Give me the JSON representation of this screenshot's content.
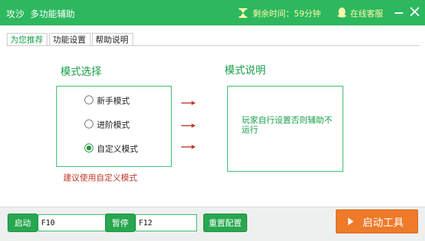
{
  "window": {
    "app_name": "攻沙",
    "subtitle": "多功能辅助",
    "timer_text": "剩余时间：59分钟",
    "service_text": "在线客服",
    "title_bg": "#2db85f"
  },
  "tabs": [
    {
      "label": "为您推荐",
      "active": true
    },
    {
      "label": "功能设置",
      "active": false
    },
    {
      "label": "帮助说明",
      "active": false
    }
  ],
  "mode_section": {
    "title": "模式选择",
    "options": [
      {
        "label": "新手模式",
        "checked": false
      },
      {
        "label": "进阶模式",
        "checked": false
      },
      {
        "label": "自定义模式",
        "checked": true
      }
    ],
    "suggestion": "建议使用自定义模式"
  },
  "description": {
    "title": "模式说明",
    "text": "玩家自行设置否则辅助不运行"
  },
  "bottom": {
    "start_label": "启动",
    "start_key": "F10",
    "pause_label": "暂停",
    "pause_key": "F12",
    "reset_label": "重置配置",
    "launch_label": "启动工具"
  },
  "colors": {
    "accent_green": "#2db85f",
    "launch_orange": "#ee7a2a",
    "suggestion_red": "#c0392b"
  },
  "icons": [
    "hourglass-icon",
    "qq-penguin-icon",
    "minimize-icon",
    "close-icon",
    "red-arrow-icon",
    "play-icon"
  ]
}
